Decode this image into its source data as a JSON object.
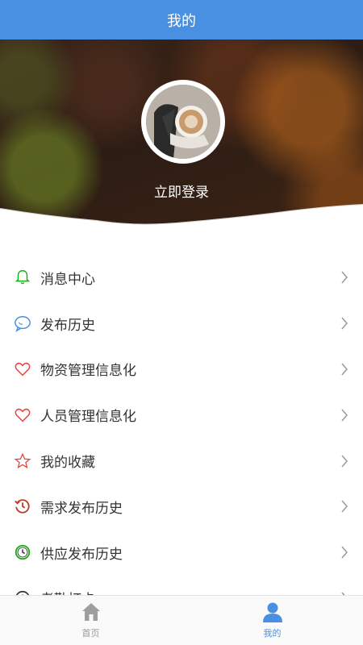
{
  "header": {
    "title": "我的"
  },
  "profile": {
    "login_label": "立即登录"
  },
  "menu": {
    "items": [
      {
        "label": "消息中心",
        "icon": "bell-icon",
        "color": "#1aad19"
      },
      {
        "label": "发布历史",
        "icon": "chat-bubble-icon",
        "color": "#4a90e2"
      },
      {
        "label": "物资管理信息化",
        "icon": "heart-icon",
        "color": "#e64340"
      },
      {
        "label": "人员管理信息化",
        "icon": "heart-icon",
        "color": "#e64340"
      },
      {
        "label": "我的收藏",
        "icon": "star-icon",
        "color": "#e64340"
      },
      {
        "label": "需求发布历史",
        "icon": "history-icon",
        "color": "#c0392b"
      },
      {
        "label": "供应发布历史",
        "icon": "clock-icon",
        "color": "#1aad19"
      },
      {
        "label": "考勤打卡",
        "icon": "clock-icon",
        "color": "#333333"
      }
    ]
  },
  "tabbar": {
    "tabs": [
      {
        "label": "首页",
        "icon": "home-icon",
        "active": false
      },
      {
        "label": "我的",
        "icon": "user-icon",
        "active": true
      }
    ],
    "active_color": "#4a90e2",
    "inactive_color": "#999999"
  }
}
